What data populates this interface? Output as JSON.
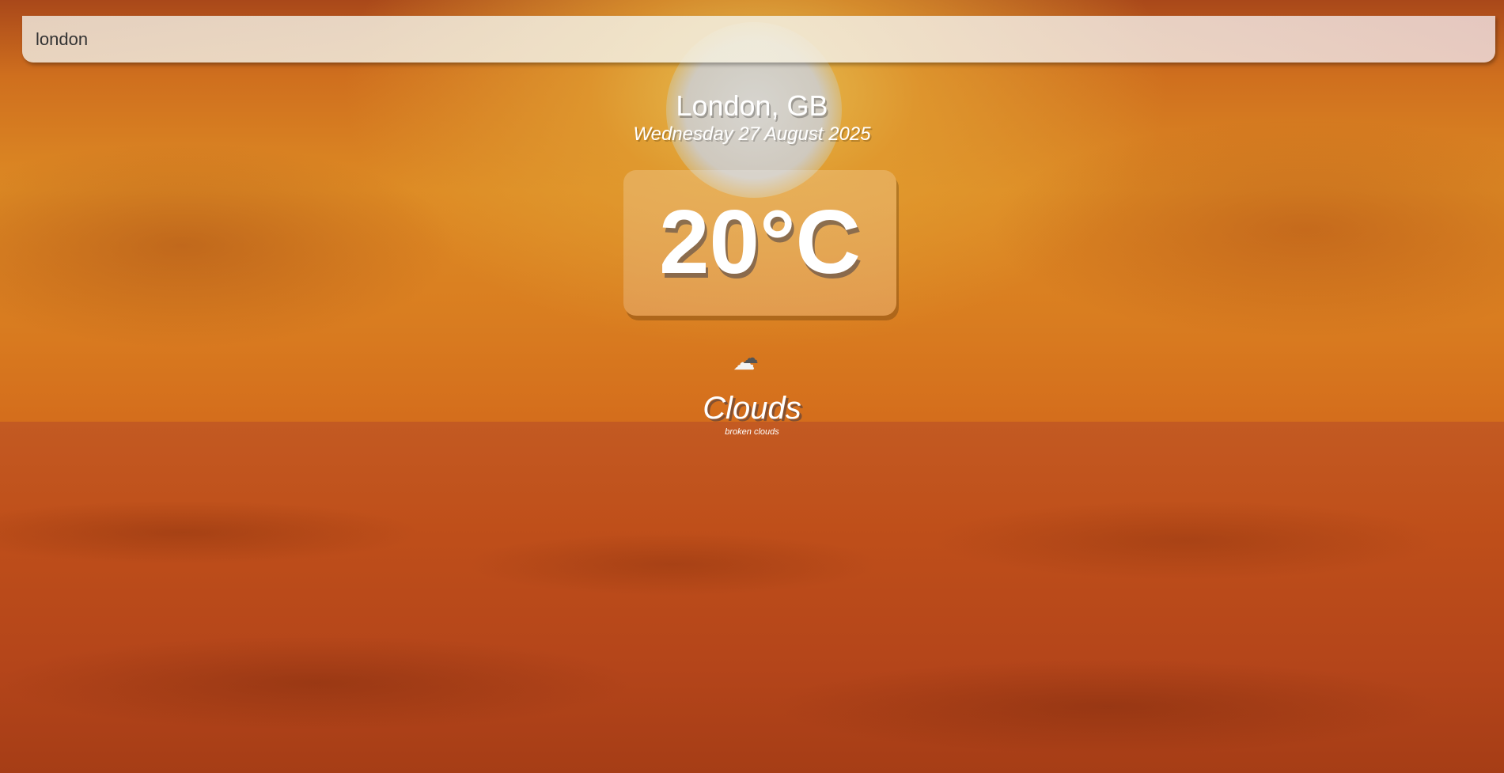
{
  "search": {
    "value": "london",
    "placeholder": "Search..."
  },
  "location": {
    "city_country": "London, GB",
    "date": "Wednesday 27 August 2025"
  },
  "weather": {
    "temperature": "20°C",
    "icon": "broken-clouds-icon",
    "icon_glyphs": [
      "☁",
      "☁"
    ],
    "condition": "Clouds",
    "description": "broken clouds"
  },
  "colors": {
    "sky_top": "#a9481a",
    "sky_mid": "#dd8a24",
    "ground": "#bf4f1a",
    "text": "#ffffff"
  }
}
